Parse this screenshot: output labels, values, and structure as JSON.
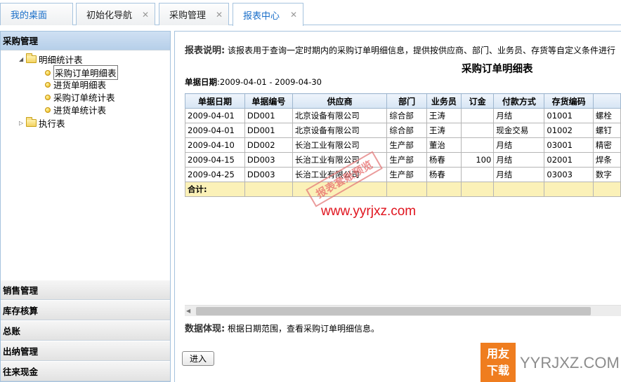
{
  "tabs": [
    {
      "label": "我的桌面",
      "closable": false
    },
    {
      "label": "初始化导航",
      "closable": true
    },
    {
      "label": "采购管理",
      "closable": true
    },
    {
      "label": "报表中心",
      "closable": true,
      "active": true
    }
  ],
  "close_glyph": "✕",
  "sidebar": {
    "active_panel": "采购管理",
    "tree": {
      "folder_open": "明细统计表",
      "items": [
        "采购订单明细表",
        "进货单明细表",
        "采购订单统计表",
        "进货单统计表"
      ],
      "selected": "采购订单明细表",
      "folder_closed": "执行表"
    },
    "panels": [
      "销售管理",
      "库存核算",
      "总账",
      "出纳管理",
      "往来现金"
    ]
  },
  "report": {
    "desc_label": "报表说明:",
    "desc_text": "该报表用于查询一定时期内的采购订单明细信息，提供按供应商、部门、业务员、存货等自定义条件进行",
    "title": "采购订单明细表",
    "date_label": "单据日期",
    "date_range": ":2009-04-01 - 2009-04-30",
    "columns": [
      "单据日期",
      "单据编号",
      "供应商",
      "部门",
      "业务员",
      "订金",
      "付款方式",
      "存货编码",
      ""
    ],
    "rows": [
      [
        "2009-04-01",
        "DD001",
        "北京设备有限公司",
        "综合部",
        "王涛",
        "",
        "月结",
        "01001",
        "螺栓"
      ],
      [
        "2009-04-01",
        "DD001",
        "北京设备有限公司",
        "综合部",
        "王涛",
        "",
        "现金交易",
        "01002",
        "螺钉"
      ],
      [
        "2009-04-10",
        "DD002",
        "长治工业有限公司",
        "生产部",
        "董治",
        "",
        "月结",
        "03001",
        "精密"
      ],
      [
        "2009-04-15",
        "DD003",
        "长治工业有限公司",
        "生产部",
        "杨春",
        "100",
        "月结",
        "02001",
        "焊条"
      ],
      [
        "2009-04-25",
        "DD003",
        "长治工业有限公司",
        "生产部",
        "杨春",
        "",
        "月结",
        "03003",
        "数字"
      ]
    ],
    "total_label": "合计:",
    "data_label": "数据体现:",
    "data_text": "根据日期范围，查看采购订单明细信息。",
    "enter_button": "进入"
  },
  "watermark": {
    "stamp": "报表套账预览",
    "url": "www.yyrjxz.com",
    "logo_box_line1": "用友",
    "logo_box_line2": "下载",
    "logo_text": "YYRJXZ.COM"
  },
  "colors": {
    "accent": "#1a6fc9",
    "header_bg": "#d7e5f4",
    "total_bg": "#fbf1b8",
    "logo": "#ef7d1f"
  }
}
